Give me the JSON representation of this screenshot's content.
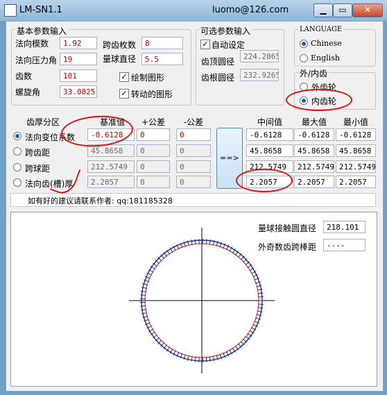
{
  "window": {
    "title": "LM-SN1.1",
    "author": "luomo@126.com",
    "controls": {
      "minimize": "▁",
      "maximize": "▭",
      "close": "✕"
    }
  },
  "basic_params": {
    "title": "基本参数输入",
    "normal_module": {
      "label": "法向模数",
      "value": "1.92"
    },
    "normal_pressure_angle": {
      "label": "法向压力角",
      "value": "19"
    },
    "teeth": {
      "label": "齿数",
      "value": "101"
    },
    "helix_angle": {
      "label": "螺旋角",
      "value": "33.0825"
    },
    "span_teeth": {
      "label": "跨齿枚数",
      "value": "8"
    },
    "ball_diameter": {
      "label": "量球直径",
      "value": "5.5"
    },
    "draw_figure": {
      "label": "绘制图形",
      "checked": true
    },
    "rotating_figure": {
      "label": "转动的图形",
      "checked": true
    }
  },
  "optional_params": {
    "title": "可选参数输入",
    "auto_set": {
      "label": "自动设定",
      "checked": true
    },
    "tip_diameter": {
      "label": "齿顶圆径",
      "value": "224.2865"
    },
    "root_diameter": {
      "label": "齿根圆径",
      "value": "232.9265"
    }
  },
  "language": {
    "title": "LANGUAGE",
    "options": [
      {
        "label": "Chinese",
        "selected": true
      },
      {
        "label": "English",
        "selected": false
      }
    ]
  },
  "gear_type": {
    "title": "外/内齿",
    "options": [
      {
        "label": "外齿轮",
        "selected": false
      },
      {
        "label": "内齿轮",
        "selected": true
      }
    ]
  },
  "table": {
    "headers": {
      "division": "齿厚分区",
      "base": "基准值",
      "plus": "+公差",
      "minus": "-公差",
      "mid": "中间值",
      "max": "最大值",
      "min": "最小值"
    },
    "rows": [
      {
        "label": "法向变位系数",
        "selected": true,
        "base": "-0.6128",
        "plus": "0",
        "minus": "0",
        "mid": "-0.6128",
        "max": "-0.6128",
        "min": "-0.6128"
      },
      {
        "label": "跨齿距",
        "selected": false,
        "base": "45.8658",
        "plus": "0",
        "minus": "0",
        "mid": "45.8658",
        "max": "45.8658",
        "min": "45.8658"
      },
      {
        "label": "跨球距",
        "selected": false,
        "base": "212.5749",
        "plus": "0",
        "minus": "0",
        "mid": "212.5749",
        "max": "212.5749",
        "min": "212.5749"
      },
      {
        "label": "法向齿(槽)厚",
        "selected": false,
        "base": "2.2057",
        "plus": "0",
        "minus": "0",
        "mid": "2.2057",
        "max": "2.2057",
        "min": "2.2057"
      }
    ]
  },
  "calc_button": "==>",
  "contact": "如有好的建议请联系作者: qq:181185328",
  "drawing": {
    "ball_circle_diameter": {
      "label": "量球接触圆直径",
      "value": "218.101"
    },
    "odd_span": {
      "label": "外奇数齿跨棒距",
      "value": "----"
    },
    "colors": {
      "outer": "#1c2f8a",
      "inner": "#c02020",
      "axes": "#000000"
    }
  }
}
